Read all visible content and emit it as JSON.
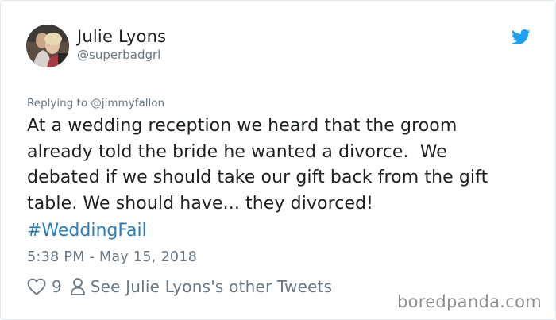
{
  "tweet": {
    "author": {
      "name": "Julie Lyons",
      "handle": "@superbadgrl"
    },
    "replying_to": "Replying to @jimmyfallon",
    "text_lines": [
      "At a wedding reception we heard that the groom",
      "already told the bride he wanted a divorce.  We",
      "debated if we should take our gift back from the gift",
      "table. We should have... they divorced!"
    ],
    "hashtag": "#WeddingFail",
    "timestamp": "5:38 PM - May 15, 2018",
    "likes": "9",
    "other_tweets_label": "See Julie Lyons's other Tweets"
  },
  "watermark": "boredpanda.com",
  "icons": {
    "brand": "twitter-bird-icon",
    "like": "heart-icon",
    "profile": "person-icon"
  },
  "colors": {
    "text": "#1c2022",
    "muted": "#697882",
    "link": "#2b7bb9",
    "twitter_blue": "#1da1f2",
    "watermark": "#8f8f8f"
  }
}
